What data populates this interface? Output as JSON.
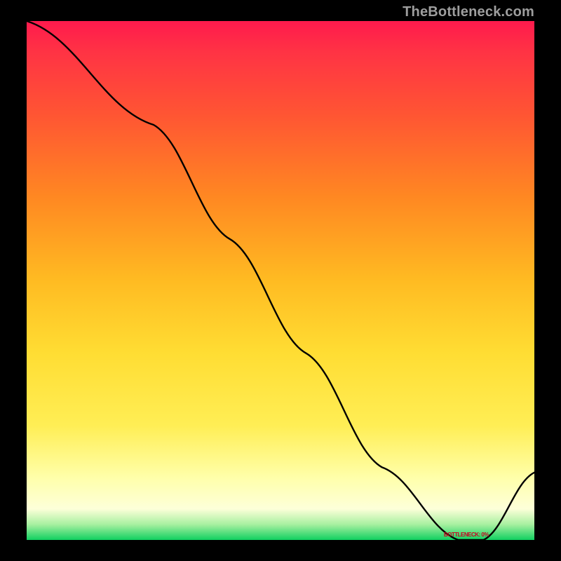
{
  "watermark": "TheBottleneck.com",
  "point_label": "BOTTLENECK: 0%",
  "chart_data": {
    "type": "line",
    "title": "",
    "xlabel": "",
    "ylabel": "",
    "x": [
      0.0,
      0.25,
      0.4,
      0.55,
      0.7,
      0.85,
      0.9,
      1.0
    ],
    "values": [
      1.0,
      0.8,
      0.58,
      0.36,
      0.14,
      0.0,
      0.0,
      0.13
    ],
    "ylim": [
      0,
      1
    ],
    "xlim": [
      0,
      1
    ],
    "gradient_colors": [
      "#ff1a4d",
      "#ffdd33",
      "#10d060"
    ],
    "annotation": {
      "x": 0.87,
      "y": 0.0,
      "text": "BOTTLENECK: 0%"
    }
  }
}
